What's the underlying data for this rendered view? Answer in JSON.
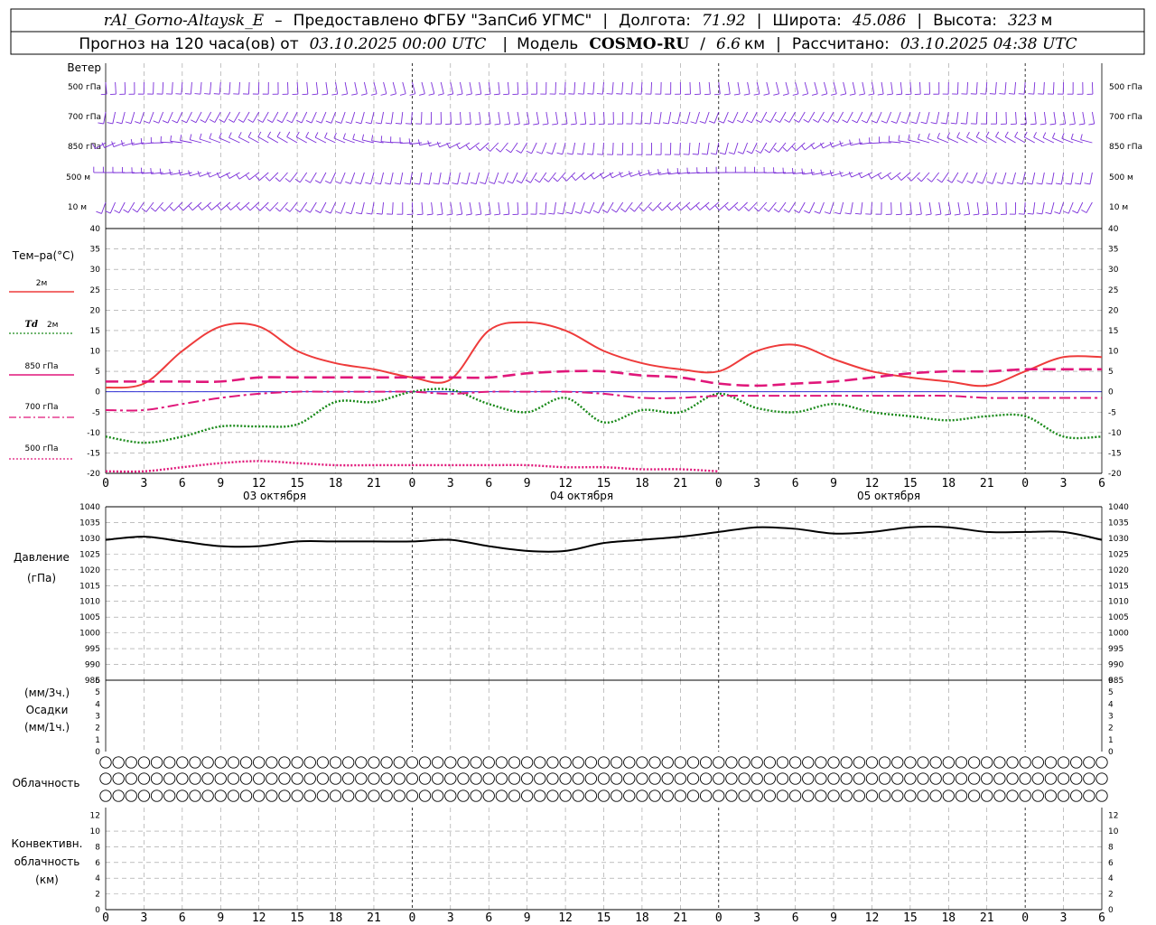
{
  "header": {
    "station": "rAl_Gorno-Altaysk_E",
    "dash": "–",
    "provider": "Предоставлено ФГБУ \"ЗапСиб УГМС\"",
    "lon_label": "Долгота:",
    "lon_value": "71.92",
    "lat_label": "Широта:",
    "lat_value": "45.086",
    "alt_label": "Высота:",
    "alt_value": "323",
    "alt_unit": "м",
    "forecast_text": "Прогноз на 120 часа(ов) от",
    "forecast_start": "03.10.2025 00:00 UTC",
    "model_label": "Модель",
    "model_name": "COSMO-RU",
    "model_res": "6.6",
    "model_res_unit": "км",
    "calc_label": "Рассчитано:",
    "calc_time": "03.10.2025 04:38 UTC"
  },
  "wind_panel": {
    "title": "Ветер",
    "levels": [
      "500 гПа",
      "700 гПа",
      "850 гПа",
      "500 м",
      "10 м"
    ],
    "color": "#7b2fd9"
  },
  "temp_panel": {
    "title": "Тем–ра(°C)",
    "legend": [
      {
        "label": "2м",
        "td_prefix": "",
        "color": "#ee3b3b",
        "style": "solid"
      },
      {
        "label": "2м",
        "td_prefix": "Td",
        "color": "#1a8a1a",
        "style": "dotted"
      },
      {
        "label": "850 гПа",
        "td_prefix": "",
        "color": "#e0177a",
        "style": "dashed"
      },
      {
        "label": "700 гПа",
        "td_prefix": "",
        "color": "#e0177a",
        "style": "dashdot"
      },
      {
        "label": "500 гПа",
        "td_prefix": "",
        "color": "#e0177a",
        "style": "dotted"
      }
    ]
  },
  "pressure_panel": {
    "title1": "Давление",
    "title2": "(гПа)"
  },
  "precip_panel": {
    "title1": "(мм/3ч.)",
    "title2": "Осадки",
    "title3": "(мм/1ч.)"
  },
  "cloud_panel": {
    "title": "Облачность"
  },
  "conv_panel": {
    "title1": "Конвективн.",
    "title2": "облачность",
    "title3": "(км)"
  },
  "x_axis": {
    "tick_labels": [
      "0",
      "3",
      "6",
      "9",
      "12",
      "15",
      "18",
      "21",
      "0",
      "3",
      "6",
      "9",
      "12",
      "15",
      "18",
      "21",
      "0",
      "3",
      "6",
      "9",
      "12",
      "15",
      "18",
      "21",
      "0",
      "3",
      "6"
    ],
    "day_labels": [
      "03 октября",
      "04 октября",
      "05 октября"
    ]
  },
  "chart_data": [
    {
      "type": "line",
      "panel": "temperature",
      "x_unit": "hours since 03.10.2025 00:00 UTC",
      "ylim": [
        -20,
        40
      ],
      "yticks": [
        -20,
        -15,
        -10,
        -5,
        0,
        5,
        10,
        15,
        20,
        25,
        30,
        35,
        40
      ],
      "grid": true,
      "series": [
        {
          "name": "2м",
          "color": "#ee3b3b",
          "style": "solid",
          "x": [
            0,
            3,
            6,
            9,
            12,
            15,
            18,
            21,
            24,
            27,
            30,
            33,
            36,
            39,
            42,
            45,
            48,
            51,
            54,
            57,
            60,
            63,
            66,
            69,
            72,
            75,
            78
          ],
          "y": [
            1,
            2,
            10,
            16,
            16,
            10,
            7,
            5.5,
            3.5,
            3,
            15,
            17,
            15,
            10,
            7,
            5.5,
            5,
            10,
            11.5,
            8,
            5,
            3.5,
            2.5,
            1.5,
            5,
            8.5,
            8.5
          ]
        },
        {
          "name": "Td 2м",
          "color": "#1a8a1a",
          "style": "dotted",
          "x": [
            0,
            3,
            6,
            9,
            12,
            15,
            18,
            21,
            24,
            27,
            30,
            33,
            36,
            39,
            42,
            45,
            48,
            51,
            54,
            57,
            60,
            63,
            66,
            69,
            72,
            75,
            78
          ],
          "y": [
            -11,
            -12.5,
            -11,
            -8.5,
            -8.5,
            -8,
            -2.5,
            -2.5,
            0,
            0.5,
            -3,
            -5,
            -1.5,
            -7.5,
            -4.5,
            -5,
            -0.5,
            -4,
            -5,
            -3,
            -5,
            -6,
            -7,
            -6,
            -6,
            -11,
            -11
          ]
        },
        {
          "name": "850 гПа",
          "color": "#e0177a",
          "style": "dashed",
          "x": [
            0,
            3,
            6,
            9,
            12,
            15,
            18,
            21,
            24,
            27,
            30,
            33,
            36,
            39,
            42,
            45,
            48,
            51,
            54,
            57,
            60,
            63,
            66,
            69,
            72,
            75,
            78
          ],
          "y": [
            2.5,
            2.5,
            2.5,
            2.5,
            3.5,
            3.5,
            3.5,
            3.5,
            3.5,
            3.5,
            3.5,
            4.5,
            5,
            5,
            4,
            3.5,
            2,
            1.5,
            2,
            2.5,
            3.5,
            4.5,
            5,
            5,
            5.5,
            5.5,
            5.5
          ]
        },
        {
          "name": "700 гПа",
          "color": "#e0177a",
          "style": "dashdot",
          "x": [
            0,
            3,
            6,
            9,
            12,
            15,
            18,
            21,
            24,
            27,
            30,
            33,
            36,
            39,
            42,
            45,
            48,
            51,
            54,
            57,
            60,
            63,
            66,
            69,
            72,
            75,
            78
          ],
          "y": [
            -4.5,
            -4.5,
            -3,
            -1.5,
            -0.5,
            0,
            0,
            0,
            0,
            -0.5,
            0,
            0,
            0,
            -0.5,
            -1.5,
            -1.5,
            -1,
            -1,
            -1,
            -1,
            -1,
            -1,
            -1,
            -1.5,
            -1.5,
            -1.5,
            -1.5
          ]
        },
        {
          "name": "500 гПа",
          "color": "#e0177a",
          "style": "dotted",
          "x": [
            0,
            3,
            6,
            9,
            12,
            15,
            18,
            21,
            24,
            27,
            30,
            33,
            36,
            39,
            42,
            45,
            48
          ],
          "y": [
            -19.5,
            -19.5,
            -18.5,
            -17.5,
            -17,
            -17.5,
            -18,
            -18,
            -18,
            -18,
            -18,
            -18,
            -18.5,
            -18.5,
            -19,
            -19,
            -19.5
          ]
        }
      ]
    },
    {
      "type": "line",
      "panel": "pressure",
      "x_unit": "hours since 03.10.2025 00:00 UTC",
      "ylim": [
        985,
        1040
      ],
      "yticks": [
        985,
        990,
        995,
        1000,
        1005,
        1010,
        1015,
        1020,
        1025,
        1030,
        1035,
        1040
      ],
      "grid": true,
      "series": [
        {
          "name": "",
          "color": "#000000",
          "style": "solid",
          "x": [
            0,
            3,
            6,
            9,
            12,
            15,
            18,
            21,
            24,
            27,
            30,
            33,
            36,
            39,
            42,
            45,
            48,
            51,
            54,
            57,
            60,
            63,
            66,
            69,
            72,
            75,
            78
          ],
          "y": [
            1029.5,
            1030.5,
            1029,
            1027.5,
            1027.5,
            1029,
            1029,
            1029,
            1029,
            1029.5,
            1027.5,
            1026,
            1026,
            1028.5,
            1029.5,
            1030.5,
            1032,
            1033.5,
            1033,
            1031.5,
            1032,
            1033.5,
            1033.5,
            1032,
            1032,
            1032,
            1029.5
          ]
        }
      ]
    },
    {
      "type": "bar",
      "panel": "precipitation",
      "ylim": [
        0,
        6
      ],
      "yticks": [
        0,
        1,
        2,
        3,
        4,
        5,
        6
      ],
      "values": []
    },
    {
      "type": "bar",
      "panel": "convective_cloud",
      "ylim": [
        0,
        13
      ],
      "yticks": [
        0,
        2,
        4,
        6,
        8,
        10,
        12
      ],
      "values": []
    }
  ]
}
